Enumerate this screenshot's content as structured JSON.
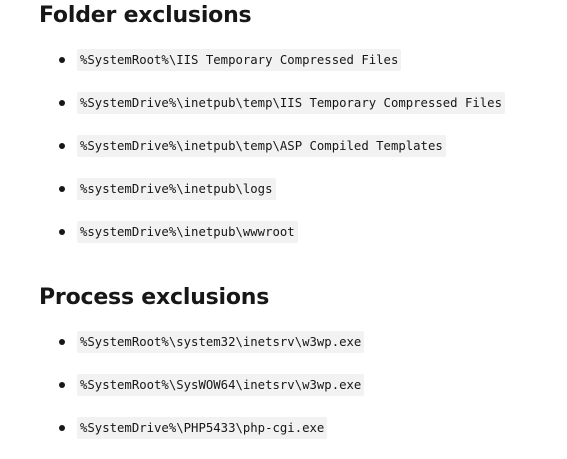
{
  "sections": [
    {
      "heading": "Folder exclusions",
      "items": [
        "%SystemRoot%\\IIS Temporary Compressed Files",
        "%SystemDrive%\\inetpub\\temp\\IIS Temporary Compressed Files",
        "%SystemDrive%\\inetpub\\temp\\ASP Compiled Templates",
        "%systemDrive%\\inetpub\\logs",
        "%systemDrive%\\inetpub\\wwwroot"
      ]
    },
    {
      "heading": "Process exclusions",
      "items": [
        "%SystemRoot%\\system32\\inetsrv\\w3wp.exe",
        "%SystemRoot%\\SysWOW64\\inetsrv\\w3wp.exe",
        "%SystemDrive%\\PHP5433\\php-cgi.exe"
      ]
    }
  ]
}
